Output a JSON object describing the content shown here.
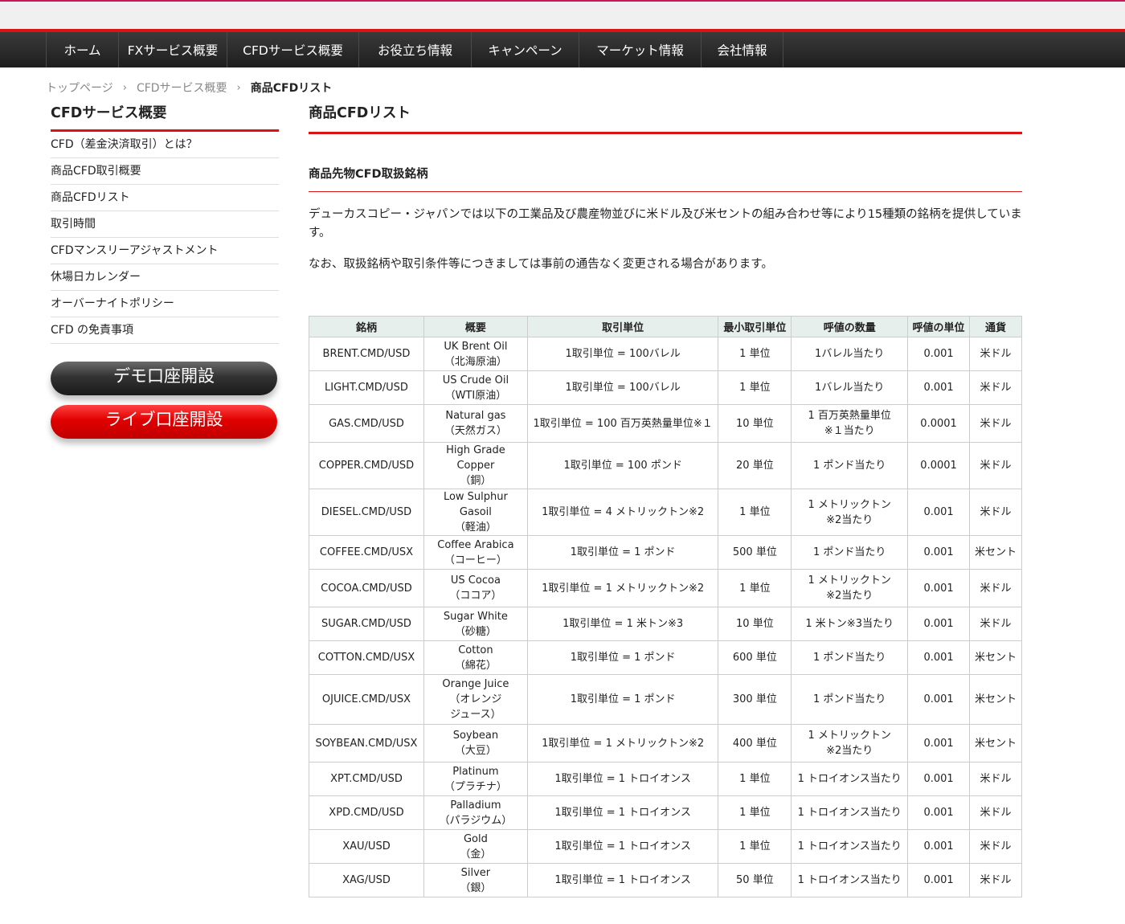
{
  "nav": [
    "ホーム",
    "FXサービス概要",
    "CFDサービス概要",
    "お役立ち情報",
    "キャンペーン",
    "マーケット情報",
    "会社情報"
  ],
  "breadcrumb": {
    "home": "トップページ",
    "parent": "CFDサービス概要",
    "current": "商品CFDリスト",
    "separator": "›"
  },
  "sidebar": {
    "title": "CFDサービス概要",
    "items": [
      "CFD（差金決済取引）とは？",
      "商品CFD取引概要",
      "商品CFDリスト",
      "取引時間",
      "CFDマンスリーアジャストメント",
      "休場日カレンダー",
      "オーバーナイトポリシー",
      "CFD の免責事項"
    ],
    "demo_button": "デモ口座開設",
    "live_button": "ライブ口座開設"
  },
  "main": {
    "title": "商品CFDリスト",
    "subtitle": "商品先物CFD取扱銘柄",
    "para1": "デューカスコピー・ジャパンでは以下の工業品及び農産物並びに米ドル及び米セントの組み合わせ等により15種類の銘柄を提供しています。",
    "para2": "なお、取扱銘柄や取引条件等につきましては事前の通告なく変更される場合があります。"
  },
  "table": {
    "headers": [
      "銘柄",
      "概要",
      "取引単位",
      "最小取引単位",
      "呼値の数量",
      "呼値の単位",
      "通貨"
    ],
    "rows": [
      [
        "BRENT.CMD/USD",
        "UK Brent Oil\n（北海原油）",
        "1取引単位 = 100バレル",
        "1 単位",
        "1バレル当たり",
        "0.001",
        "米ドル"
      ],
      [
        "LIGHT.CMD/USD",
        "US Crude Oil\n（WTI原油）",
        "1取引単位 = 100バレル",
        "1 単位",
        "1バレル当たり",
        "0.001",
        "米ドル"
      ],
      [
        "GAS.CMD/USD",
        "Natural gas\n（天然ガス）",
        "1取引単位 = 100 百万英熱量単位※１",
        "10 単位",
        "1 百万英熱量単位\n※１当たり",
        "0.0001",
        "米ドル"
      ],
      [
        "COPPER.CMD/USD",
        "High Grade Copper\n（銅）",
        "1取引単位 = 100 ポンド",
        "20 単位",
        "1 ポンド当たり",
        "0.0001",
        "米ドル"
      ],
      [
        "DIESEL.CMD/USD",
        "Low Sulphur Gasoil\n（軽油）",
        "1取引単位 = 4 メトリックトン※2",
        "1 単位",
        "1 メトリックトン\n※2当たり",
        "0.001",
        "米ドル"
      ],
      [
        "COFFEE.CMD/USX",
        "Coffee Arabica\n（コーヒー）",
        "1取引単位 = 1 ポンド",
        "500 単位",
        "1 ポンド当たり",
        "0.001",
        "米セント"
      ],
      [
        "COCOA.CMD/USD",
        "US Cocoa\n（ココア）",
        "1取引単位 = 1 メトリックトン※2",
        "1 単位",
        "1 メトリックトン\n※2当たり",
        "0.001",
        "米ドル"
      ],
      [
        "SUGAR.CMD/USD",
        "Sugar White\n（砂糖）",
        "1取引単位 = 1 米トン※3",
        "10 単位",
        "1 米トン※3当たり",
        "0.001",
        "米ドル"
      ],
      [
        "COTTON.CMD/USX",
        "Cotton\n（綿花）",
        "1取引単位 = 1 ポンド",
        "600 単位",
        "1 ポンド当たり",
        "0.001",
        "米セント"
      ],
      [
        "OJUICE.CMD/USX",
        "Orange Juice\n（オレンジ\nジュース）",
        "1取引単位 = 1 ポンド",
        "300 単位",
        "1 ポンド当たり",
        "0.001",
        "米セント"
      ],
      [
        "SOYBEAN.CMD/USX",
        "Soybean\n（大豆）",
        "1取引単位 = 1 メトリックトン※2",
        "400 単位",
        "1 メトリックトン\n※2当たり",
        "0.001",
        "米セント"
      ],
      [
        "XPT.CMD/USD",
        "Platinum\n（プラチナ）",
        "1取引単位 = 1 トロイオンス",
        "1 単位",
        "1 トロイオンス当たり",
        "0.001",
        "米ドル"
      ],
      [
        "XPD.CMD/USD",
        "Palladium\n（パラジウム）",
        "1取引単位 = 1 トロイオンス",
        "1 単位",
        "1 トロイオンス当たり",
        "0.001",
        "米ドル"
      ],
      [
        "XAU/USD",
        "Gold\n（金）",
        "1取引単位 = 1 トロイオンス",
        "1 単位",
        "1 トロイオンス当たり",
        "0.001",
        "米ドル"
      ],
      [
        "XAG/USD",
        "Silver\n（銀）",
        "1取引単位 = 1 トロイオンス",
        "50 単位",
        "1 トロイオンス当たり",
        "0.001",
        "米ドル"
      ]
    ]
  },
  "colors": {
    "accent": "#d81414",
    "nav_bg": "#2a2a2a",
    "table_header_bg": "#e6efec"
  }
}
